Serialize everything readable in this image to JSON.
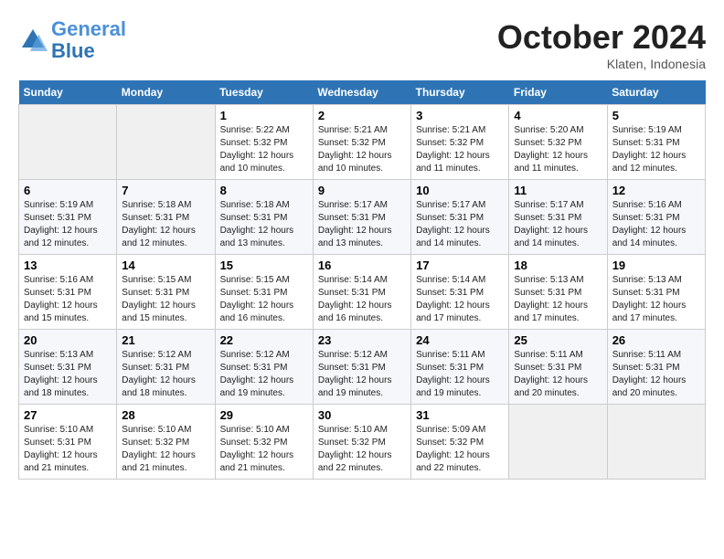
{
  "header": {
    "logo_line1": "General",
    "logo_line2": "Blue",
    "month": "October 2024",
    "location": "Klaten, Indonesia"
  },
  "days_of_week": [
    "Sunday",
    "Monday",
    "Tuesday",
    "Wednesday",
    "Thursday",
    "Friday",
    "Saturday"
  ],
  "weeks": [
    [
      {
        "day": "",
        "empty": true
      },
      {
        "day": "",
        "empty": true
      },
      {
        "day": "1",
        "sunrise": "5:22 AM",
        "sunset": "5:32 PM",
        "daylight": "12 hours and 10 minutes."
      },
      {
        "day": "2",
        "sunrise": "5:21 AM",
        "sunset": "5:32 PM",
        "daylight": "12 hours and 10 minutes."
      },
      {
        "day": "3",
        "sunrise": "5:21 AM",
        "sunset": "5:32 PM",
        "daylight": "12 hours and 11 minutes."
      },
      {
        "day": "4",
        "sunrise": "5:20 AM",
        "sunset": "5:32 PM",
        "daylight": "12 hours and 11 minutes."
      },
      {
        "day": "5",
        "sunrise": "5:19 AM",
        "sunset": "5:31 PM",
        "daylight": "12 hours and 12 minutes."
      }
    ],
    [
      {
        "day": "6",
        "sunrise": "5:19 AM",
        "sunset": "5:31 PM",
        "daylight": "12 hours and 12 minutes."
      },
      {
        "day": "7",
        "sunrise": "5:18 AM",
        "sunset": "5:31 PM",
        "daylight": "12 hours and 12 minutes."
      },
      {
        "day": "8",
        "sunrise": "5:18 AM",
        "sunset": "5:31 PM",
        "daylight": "12 hours and 13 minutes."
      },
      {
        "day": "9",
        "sunrise": "5:17 AM",
        "sunset": "5:31 PM",
        "daylight": "12 hours and 13 minutes."
      },
      {
        "day": "10",
        "sunrise": "5:17 AM",
        "sunset": "5:31 PM",
        "daylight": "12 hours and 14 minutes."
      },
      {
        "day": "11",
        "sunrise": "5:17 AM",
        "sunset": "5:31 PM",
        "daylight": "12 hours and 14 minutes."
      },
      {
        "day": "12",
        "sunrise": "5:16 AM",
        "sunset": "5:31 PM",
        "daylight": "12 hours and 14 minutes."
      }
    ],
    [
      {
        "day": "13",
        "sunrise": "5:16 AM",
        "sunset": "5:31 PM",
        "daylight": "12 hours and 15 minutes."
      },
      {
        "day": "14",
        "sunrise": "5:15 AM",
        "sunset": "5:31 PM",
        "daylight": "12 hours and 15 minutes."
      },
      {
        "day": "15",
        "sunrise": "5:15 AM",
        "sunset": "5:31 PM",
        "daylight": "12 hours and 16 minutes."
      },
      {
        "day": "16",
        "sunrise": "5:14 AM",
        "sunset": "5:31 PM",
        "daylight": "12 hours and 16 minutes."
      },
      {
        "day": "17",
        "sunrise": "5:14 AM",
        "sunset": "5:31 PM",
        "daylight": "12 hours and 17 minutes."
      },
      {
        "day": "18",
        "sunrise": "5:13 AM",
        "sunset": "5:31 PM",
        "daylight": "12 hours and 17 minutes."
      },
      {
        "day": "19",
        "sunrise": "5:13 AM",
        "sunset": "5:31 PM",
        "daylight": "12 hours and 17 minutes."
      }
    ],
    [
      {
        "day": "20",
        "sunrise": "5:13 AM",
        "sunset": "5:31 PM",
        "daylight": "12 hours and 18 minutes."
      },
      {
        "day": "21",
        "sunrise": "5:12 AM",
        "sunset": "5:31 PM",
        "daylight": "12 hours and 18 minutes."
      },
      {
        "day": "22",
        "sunrise": "5:12 AM",
        "sunset": "5:31 PM",
        "daylight": "12 hours and 19 minutes."
      },
      {
        "day": "23",
        "sunrise": "5:12 AM",
        "sunset": "5:31 PM",
        "daylight": "12 hours and 19 minutes."
      },
      {
        "day": "24",
        "sunrise": "5:11 AM",
        "sunset": "5:31 PM",
        "daylight": "12 hours and 19 minutes."
      },
      {
        "day": "25",
        "sunrise": "5:11 AM",
        "sunset": "5:31 PM",
        "daylight": "12 hours and 20 minutes."
      },
      {
        "day": "26",
        "sunrise": "5:11 AM",
        "sunset": "5:31 PM",
        "daylight": "12 hours and 20 minutes."
      }
    ],
    [
      {
        "day": "27",
        "sunrise": "5:10 AM",
        "sunset": "5:31 PM",
        "daylight": "12 hours and 21 minutes."
      },
      {
        "day": "28",
        "sunrise": "5:10 AM",
        "sunset": "5:32 PM",
        "daylight": "12 hours and 21 minutes."
      },
      {
        "day": "29",
        "sunrise": "5:10 AM",
        "sunset": "5:32 PM",
        "daylight": "12 hours and 21 minutes."
      },
      {
        "day": "30",
        "sunrise": "5:10 AM",
        "sunset": "5:32 PM",
        "daylight": "12 hours and 22 minutes."
      },
      {
        "day": "31",
        "sunrise": "5:09 AM",
        "sunset": "5:32 PM",
        "daylight": "12 hours and 22 minutes."
      },
      {
        "day": "",
        "empty": true
      },
      {
        "day": "",
        "empty": true
      }
    ]
  ]
}
